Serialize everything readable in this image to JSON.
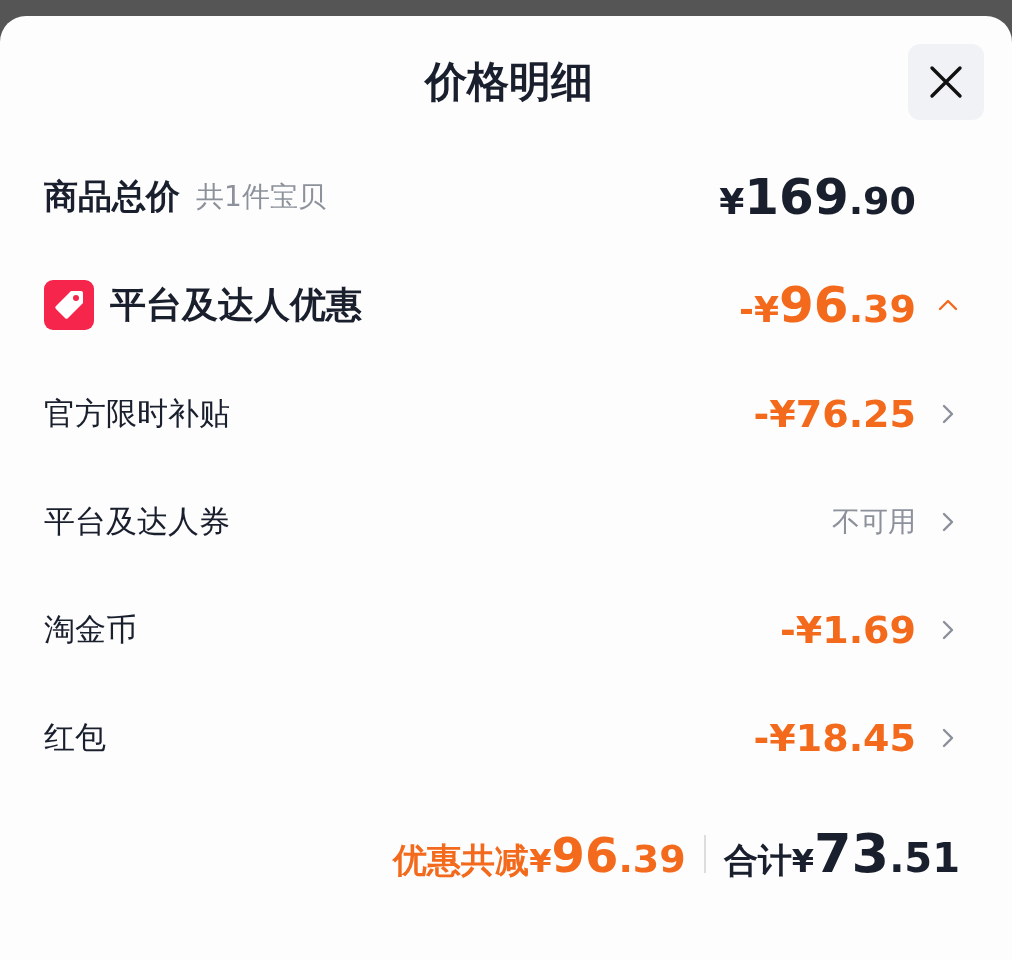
{
  "title": "价格明细",
  "total": {
    "label": "商品总价",
    "sub": "共1件宝贝",
    "price": "¥169.90"
  },
  "discount": {
    "label": "平台及达人优惠",
    "price": "-¥96.39",
    "expanded": true,
    "items": [
      {
        "label": "官方限时补贴",
        "kind": "amount",
        "value": "-¥76.25"
      },
      {
        "label": "平台及达人券",
        "kind": "unavailable",
        "value": "不可用"
      },
      {
        "label": "淘金币",
        "kind": "amount",
        "value": "-¥1.69"
      },
      {
        "label": "红包",
        "kind": "amount",
        "value": "-¥18.45"
      }
    ]
  },
  "footer": {
    "saved_label": "优惠共减",
    "saved_price": "¥96.39",
    "total_label": "合计",
    "total_price": "¥73.51"
  }
}
